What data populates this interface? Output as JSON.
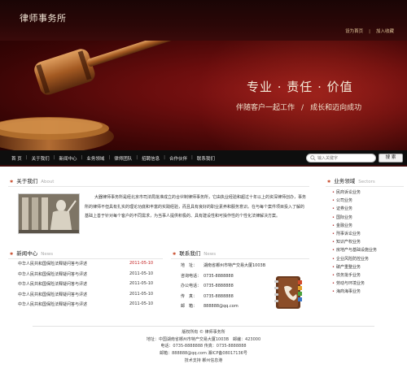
{
  "header": {
    "logo": "律师事务所",
    "links": [
      "设为首页",
      "加入收藏"
    ]
  },
  "banner": {
    "slogan_main": "专业 · 责任 · 价值",
    "slogan_sub_1": "伴随客户一起工作",
    "slogan_sub_sep": "/",
    "slogan_sub_2": "成长和迈向成功"
  },
  "nav": {
    "items": [
      "首 页",
      "关于我们",
      "新闻中心",
      "业务领域",
      "律师团队",
      "招聘信息",
      "合作伙伴",
      "联系我们"
    ],
    "search_placeholder": "输入关键字",
    "search_button": "搜 索"
  },
  "about": {
    "title": "关于我们",
    "title_en": "About",
    "text": "大器律师事务所是经北京市司法局批准成立的合伙制律师事务所，它由执业经验和超过十年以上的资深律师创办，事务所的律师不但具有扎实的理论功底和丰富的实践经验，而且具有良好的职业素养和服务意识。在与每个案件项目投入了解的基础上善于针对每个客户的不同需求，为当事人提供积极的、具有建设性和可操作性的个性化法律解决方案。"
  },
  "news": {
    "title": "新闻中心",
    "title_en": "News",
    "items": [
      {
        "title": "中华人民共和国保险法释疑问答与评述",
        "date": "2011-05-10",
        "highlight": true
      },
      {
        "title": "中华人民共和国保险法释疑问答与评述",
        "date": "2011-05-10",
        "highlight": false
      },
      {
        "title": "中华人民共和国保险法释疑问答与评述",
        "date": "2011-05-10",
        "highlight": false
      },
      {
        "title": "中华人民共和国保险法释疑问答与评述",
        "date": "2011-05-10",
        "highlight": false
      },
      {
        "title": "中华人民共和国保险法释疑问答与评述",
        "date": "2011-05-10",
        "highlight": false
      }
    ]
  },
  "contact": {
    "title": "联系我们",
    "title_en": "News",
    "rows": [
      {
        "k": "地　址：",
        "v": "湖南省郴州市特产交易大厦1003B"
      },
      {
        "k": "咨询电话：",
        "v": "0735-8888888"
      },
      {
        "k": "办公电话：",
        "v": "0735-8888888"
      },
      {
        "k": "传　真：",
        "v": "0735-8888888"
      },
      {
        "k": "邮　箱：",
        "v": "888888@qq.com"
      }
    ]
  },
  "services": {
    "title": "业务领域",
    "title_en": "Sectors",
    "items": [
      "民商诉讼业务",
      "公司业务",
      "证券业务",
      "国际业务",
      "金融业务",
      "刑事诉讼业务",
      "知识产权业务",
      "房地产与基础设施业务",
      "企业风险防控业务",
      "破产重整业务",
      "债务批手业务",
      "劳动与环境业务",
      "海商海事业务"
    ]
  },
  "footer": {
    "lines": [
      "版权所有 © 律师事务所",
      "地址：中国湖南省郴州市特产交易大厦1003B　邮编：423000",
      "电话：0735-8888888 传真：0735-8888888",
      "邮箱：888888@qq.com 湘ICP备08017136号",
      "技术支持 郴州信息港"
    ]
  },
  "colors": {
    "header_bg": "#2a0707",
    "banner_red": "#8a1616",
    "nav_bg": "#0e0e0e",
    "accent_red": "#c21b1b",
    "gold": "#e2c79a"
  }
}
